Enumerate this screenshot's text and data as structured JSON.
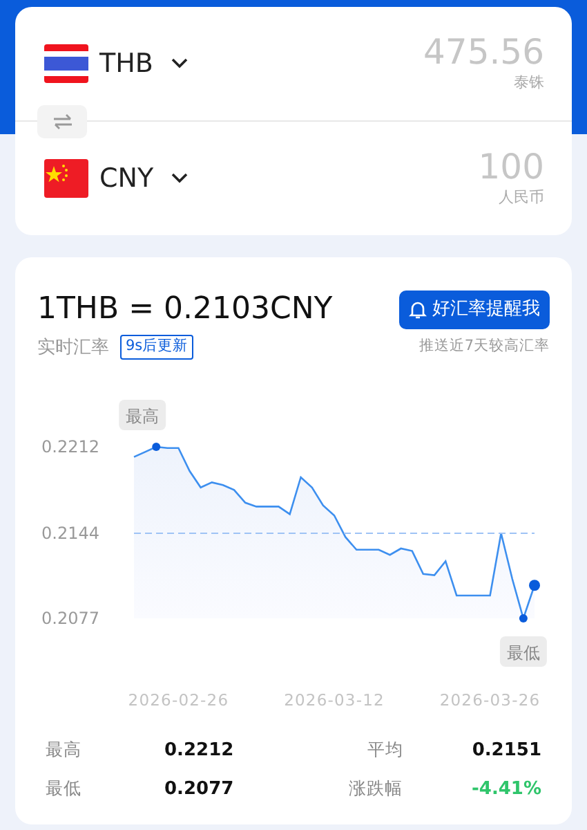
{
  "currencies": [
    {
      "code": "THB",
      "kind": "thailand",
      "amount": "475.56",
      "name": "泰铢"
    },
    {
      "code": "CNY",
      "kind": "china",
      "amount": "100",
      "name": "人民币"
    }
  ],
  "rate": {
    "title": "1THB = 0.2103CNY",
    "label": "实时汇率",
    "badge": "9s后更新",
    "alert_button": "好汇率提醒我",
    "alert_note": "推送近7天较高汇率"
  },
  "chart": {
    "chart_data": {
      "type": "area",
      "categories": [
        null,
        null,
        null,
        null,
        "2026-02-26",
        null,
        null,
        null,
        null,
        null,
        null,
        null,
        null,
        null,
        null,
        null,
        null,
        null,
        "2026-03-12",
        null,
        null,
        null,
        null,
        null,
        null,
        null,
        null,
        null,
        null,
        null,
        null,
        null,
        "2026-03-26",
        null,
        null,
        null,
        null
      ],
      "series": [
        {
          "color": "#3d8fef",
          "values": [
            0.2204,
            0.2208,
            0.2212,
            0.2211,
            0.2211,
            0.2193,
            0.218,
            0.2184,
            0.2182,
            0.2178,
            0.2168,
            0.2165,
            0.2165,
            0.2165,
            0.2159,
            0.2188,
            0.218,
            0.2166,
            0.2158,
            0.2141,
            0.2131,
            0.2131,
            0.2131,
            0.2127,
            0.2132,
            0.213,
            0.2112,
            0.2111,
            0.2122,
            0.2095,
            0.2095,
            0.2095,
            0.2095,
            0.2144,
            0.2108,
            0.2077,
            0.2103
          ]
        }
      ],
      "ylim": [
        0.2077,
        0.2212
      ],
      "yticks": [
        0.2212,
        0.2144,
        0.2077
      ],
      "annotations": [
        {
          "text": "最高",
          "y": 0.2212
        },
        {
          "text": "最低",
          "y": 0.2077
        }
      ],
      "ref_lines": [
        {
          "axis": "y",
          "value": 0.2144
        }
      ]
    }
  },
  "stats": [
    {
      "label": "最高",
      "value": "0.2212",
      "color": "#111111"
    },
    {
      "label": "平均",
      "value": "0.2151",
      "color": "#111111"
    },
    {
      "label": "最低",
      "value": "0.2077",
      "color": "#111111"
    },
    {
      "label": "涨跌幅",
      "value": "-4.41%",
      "color": "#2fc56b"
    }
  ]
}
